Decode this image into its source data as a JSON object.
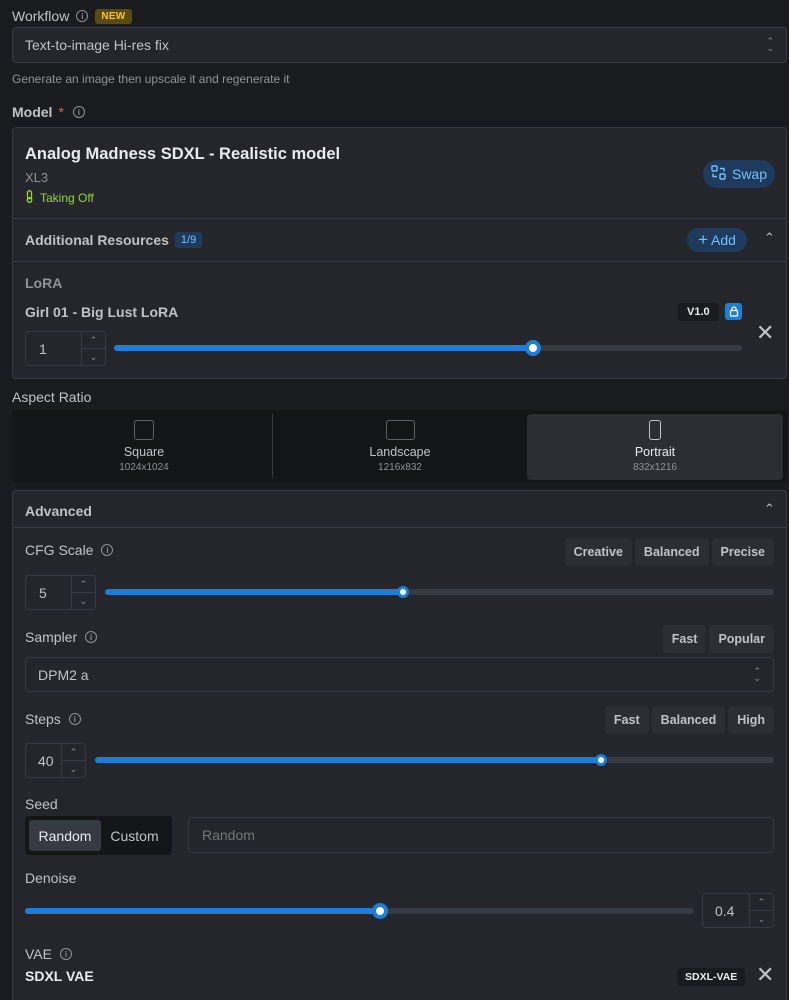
{
  "workflow": {
    "label": "Workflow",
    "badge": "NEW",
    "value": "Text-to-image Hi-res fix",
    "description": "Generate an image then upscale it and regenerate it"
  },
  "model": {
    "label": "Model",
    "required": "*",
    "name": "Analog Madness SDXL - Realistic model",
    "base": "XL3",
    "status": "Taking Off",
    "swap_label": "Swap",
    "additional_label": "Additional Resources",
    "additional_count": "1/9",
    "add_label": "Add",
    "lora_section": "LoRA",
    "lora": {
      "name": "Girl 01 - Big Lust LoRA",
      "version": "V1.0",
      "strength": "1",
      "slider_fraction": 0.667
    }
  },
  "aspect_ratio": {
    "label": "Aspect Ratio",
    "options": [
      {
        "name": "Square",
        "dims": "1024x1024"
      },
      {
        "name": "Landscape",
        "dims": "1216x832"
      },
      {
        "name": "Portrait",
        "dims": "832x1216"
      }
    ],
    "selected": "Portrait"
  },
  "advanced": {
    "title": "Advanced",
    "cfg": {
      "label": "CFG Scale",
      "value": "5",
      "presets": [
        "Creative",
        "Balanced",
        "Precise"
      ],
      "slider_fraction": 0.446
    },
    "sampler": {
      "label": "Sampler",
      "value": "DPM2 a",
      "presets": [
        "Fast",
        "Popular"
      ]
    },
    "steps": {
      "label": "Steps",
      "value": "40",
      "presets": [
        "Fast",
        "Balanced",
        "High"
      ],
      "slider_fraction": 0.745
    },
    "seed": {
      "label": "Seed",
      "modes": [
        "Random",
        "Custom"
      ],
      "selected": "Random",
      "placeholder": "Random"
    },
    "denoise": {
      "label": "Denoise",
      "value": "0.4",
      "slider_fraction": 0.53
    },
    "vae": {
      "label": "VAE",
      "name": "SDXL VAE",
      "tag": "SDXL-VAE"
    }
  }
}
